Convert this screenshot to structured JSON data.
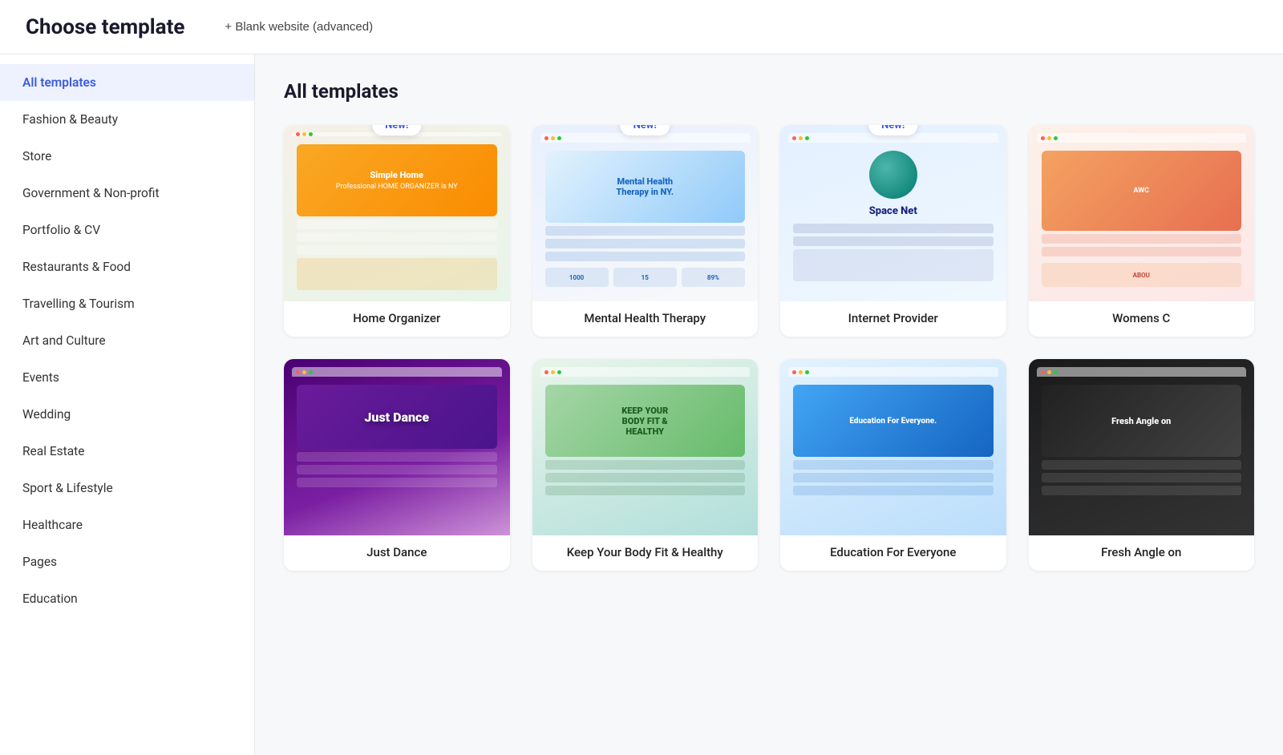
{
  "header": {
    "title": "Choose template",
    "blank_btn_label": "+ Blank website (advanced)"
  },
  "sidebar": {
    "items": [
      {
        "id": "all-templates",
        "label": "All templates",
        "active": true
      },
      {
        "id": "fashion-beauty",
        "label": "Fashion & Beauty",
        "active": false
      },
      {
        "id": "store",
        "label": "Store",
        "active": false
      },
      {
        "id": "government-nonprofit",
        "label": "Government & Non-profit",
        "active": false
      },
      {
        "id": "portfolio-cv",
        "label": "Portfolio & CV",
        "active": false
      },
      {
        "id": "restaurants-food",
        "label": "Restaurants & Food",
        "active": false
      },
      {
        "id": "travelling-tourism",
        "label": "Travelling & Tourism",
        "active": false
      },
      {
        "id": "art-culture",
        "label": "Art and Culture",
        "active": false
      },
      {
        "id": "events",
        "label": "Events",
        "active": false
      },
      {
        "id": "wedding",
        "label": "Wedding",
        "active": false
      },
      {
        "id": "real-estate",
        "label": "Real Estate",
        "active": false
      },
      {
        "id": "sport-lifestyle",
        "label": "Sport & Lifestyle",
        "active": false
      },
      {
        "id": "healthcare",
        "label": "Healthcare",
        "active": false
      },
      {
        "id": "pages",
        "label": "Pages",
        "active": false
      },
      {
        "id": "education",
        "label": "Education",
        "active": false
      }
    ]
  },
  "content": {
    "section_title": "All templates",
    "templates_row1": [
      {
        "id": "home-organizer",
        "name": "Home Organizer",
        "new": true,
        "preview_type": "home-organizer"
      },
      {
        "id": "mental-health",
        "name": "Mental Health Therapy",
        "new": true,
        "preview_type": "mental-health"
      },
      {
        "id": "internet-provider",
        "name": "Internet Provider",
        "new": true,
        "preview_type": "internet"
      },
      {
        "id": "womens-c",
        "name": "Womens C",
        "new": false,
        "preview_type": "womens"
      }
    ],
    "templates_row2": [
      {
        "id": "just-dance",
        "name": "Just Dance",
        "new": false,
        "preview_type": "dance"
      },
      {
        "id": "fitness",
        "name": "Keep Your Body Fit & Healthy",
        "new": false,
        "preview_type": "fitness"
      },
      {
        "id": "education-for-everyone",
        "name": "Education For Everyone",
        "new": false,
        "preview_type": "education"
      },
      {
        "id": "fresh-angle",
        "name": "Fresh Angle on",
        "new": false,
        "preview_type": "fresh"
      }
    ],
    "new_badge_label": "New!"
  }
}
